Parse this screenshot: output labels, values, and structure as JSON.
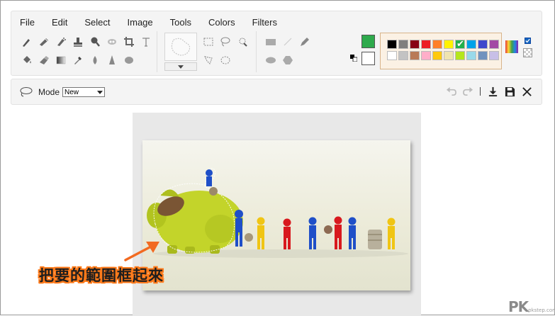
{
  "menu": {
    "items": [
      "File",
      "Edit",
      "Select",
      "Image",
      "Tools",
      "Colors",
      "Filters"
    ]
  },
  "tools": {
    "row1": [
      "brush-icon",
      "pencil-icon",
      "airbrush-icon",
      "stamp-icon",
      "magnifier-icon",
      "smudge-icon",
      "crop-icon",
      "text-icon"
    ],
    "row2": [
      "fill-bucket-icon",
      "eraser-icon",
      "gradient-icon",
      "color-picker-icon",
      "drop-icon",
      "sharpen-icon",
      "blob-icon"
    ]
  },
  "colors": {
    "foreground": "#2eaa4c",
    "background": "#ffffff",
    "palette_row1": [
      "#000000",
      "#7f7f7f",
      "#880015",
      "#ed1c24",
      "#ff7f27",
      "#fff200",
      "#22b14c",
      "#00a2e8",
      "#3f48cc",
      "#a349a4"
    ],
    "palette_row2": [
      "#ffffff",
      "#c3c3c3",
      "#b97a57",
      "#ffaec9",
      "#ffc90e",
      "#efe4b0",
      "#b5e61d",
      "#99d9ea",
      "#7092be",
      "#c8bfe7"
    ],
    "checked_index": 6
  },
  "mode": {
    "label": "Mode",
    "value": "New"
  },
  "annotation": {
    "caption": "把要的範圍框起來",
    "arrow_color": "#f26a21"
  },
  "watermark": {
    "brand": "PK",
    "site": "pkstep.com"
  }
}
